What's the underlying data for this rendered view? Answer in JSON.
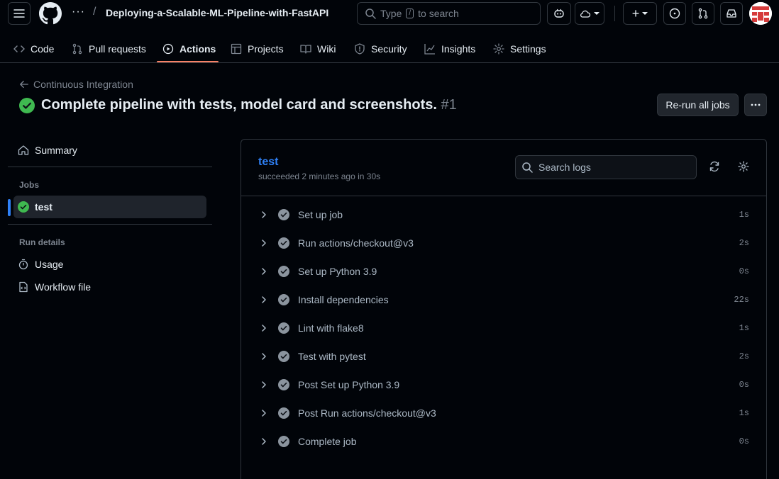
{
  "header": {
    "breadcrumb_dots": "···",
    "separator": "/",
    "repo_name": "Deploying-a-Scalable-ML-Pipeline-with-FastAPI",
    "search_prefix": "Type",
    "search_key": "/",
    "search_suffix": "to search",
    "plus_label": "+"
  },
  "nav": {
    "tabs": [
      {
        "label": "Code",
        "icon": "code-icon"
      },
      {
        "label": "Pull requests",
        "icon": "pull-request-icon"
      },
      {
        "label": "Actions",
        "icon": "play-icon",
        "active": true
      },
      {
        "label": "Projects",
        "icon": "table-icon"
      },
      {
        "label": "Wiki",
        "icon": "book-icon"
      },
      {
        "label": "Security",
        "icon": "shield-icon"
      },
      {
        "label": "Insights",
        "icon": "graph-icon"
      },
      {
        "label": "Settings",
        "icon": "gear-icon"
      }
    ]
  },
  "run": {
    "back_label": "Continuous Integration",
    "title": "Complete pipeline with tests, model card and screenshots.",
    "run_number": "#1",
    "rerun_label": "Re-run all jobs"
  },
  "sidebar": {
    "summary": "Summary",
    "jobs_heading": "Jobs",
    "job": "test",
    "run_details_heading": "Run details",
    "usage": "Usage",
    "workflow_file": "Workflow file"
  },
  "job": {
    "name": "test",
    "meta": "succeeded 2 minutes ago in 30s",
    "search_placeholder": "Search logs",
    "steps": [
      {
        "name": "Set up job",
        "duration": "1s"
      },
      {
        "name": "Run actions/checkout@v3",
        "duration": "2s"
      },
      {
        "name": "Set up Python 3.9",
        "duration": "0s"
      },
      {
        "name": "Install dependencies",
        "duration": "22s"
      },
      {
        "name": "Lint with flake8",
        "duration": "1s"
      },
      {
        "name": "Test with pytest",
        "duration": "2s"
      },
      {
        "name": "Post Set up Python 3.9",
        "duration": "0s"
      },
      {
        "name": "Post Run actions/checkout@v3",
        "duration": "1s"
      },
      {
        "name": "Complete job",
        "duration": "0s"
      }
    ]
  },
  "colors": {
    "success": "#3fb950",
    "accent_link": "#2f81f7",
    "tab_underline": "#f78166"
  }
}
